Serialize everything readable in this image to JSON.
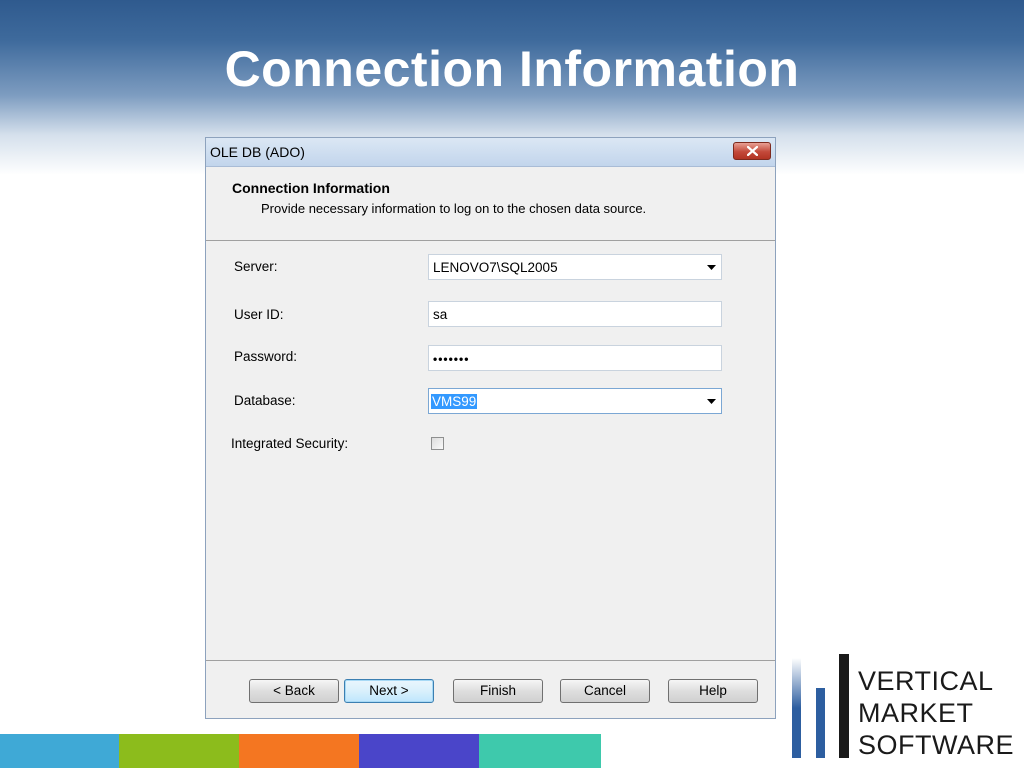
{
  "slide": {
    "title": "Connection Information"
  },
  "dialog": {
    "title": "OLE DB (ADO)",
    "header_title": "Connection Information",
    "header_subtitle": "Provide necessary information to log on to the chosen data source.",
    "fields": {
      "server": {
        "label": "Server:",
        "value": "LENOVO7\\SQL2005"
      },
      "user_id": {
        "label": "User ID:",
        "value": "sa"
      },
      "password": {
        "label": "Password:",
        "value": "•••••••"
      },
      "database": {
        "label": "Database:",
        "value": "VMS99"
      },
      "integrated_security": {
        "label": "Integrated Security:",
        "checked": false
      }
    },
    "buttons": {
      "back": "< Back",
      "next": "Next >",
      "finish": "Finish",
      "cancel": "Cancel",
      "help": "Help"
    }
  },
  "logo": {
    "line1": "VERTICAL",
    "line2": "MARKET",
    "line3": "SOFTWARE"
  },
  "colors": {
    "bar_cyan": "#3fa9d6",
    "bar_green": "#8cbc1c",
    "bar_orange": "#f47621",
    "bar_purple": "#4a45c9",
    "bar_teal": "#3ec9ac",
    "logo_blue": "#2d5ea0"
  },
  "icons": {
    "close": "close-icon",
    "dropdown": "chevron-down-icon",
    "checkbox": "checkbox-icon"
  }
}
